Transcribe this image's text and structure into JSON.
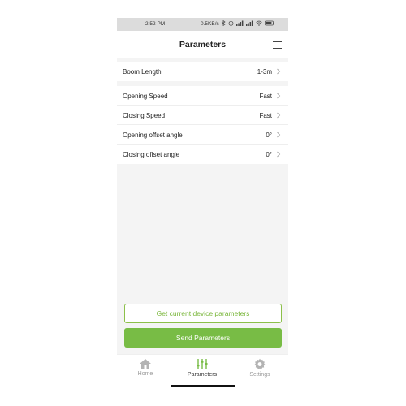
{
  "status_bar": {
    "time": "2:52 PM",
    "network_speed": "0.5KB/s"
  },
  "header": {
    "title": "Parameters",
    "menu_icon": "hamburger-menu-icon"
  },
  "params_group_1": [
    {
      "label": "Boom Length",
      "value": "1-3m"
    }
  ],
  "params_group_2": [
    {
      "label": "Opening Speed",
      "value": "Fast"
    },
    {
      "label": "Closing Speed",
      "value": "Fast"
    },
    {
      "label": "Opening offset angle",
      "value": "0°"
    },
    {
      "label": "Closing offset angle",
      "value": "0°"
    }
  ],
  "actions": {
    "get_current": "Get current device parameters",
    "send": "Send Parameters"
  },
  "tabs": [
    {
      "label": "Home",
      "icon": "home-icon",
      "active": false
    },
    {
      "label": "Parameters",
      "icon": "sliders-icon",
      "active": true
    },
    {
      "label": "Settings",
      "icon": "gear-icon",
      "active": false
    }
  ],
  "colors": {
    "accent": "#78bc45",
    "accent_text": "#79b63a",
    "background": "#f4f4f4"
  }
}
